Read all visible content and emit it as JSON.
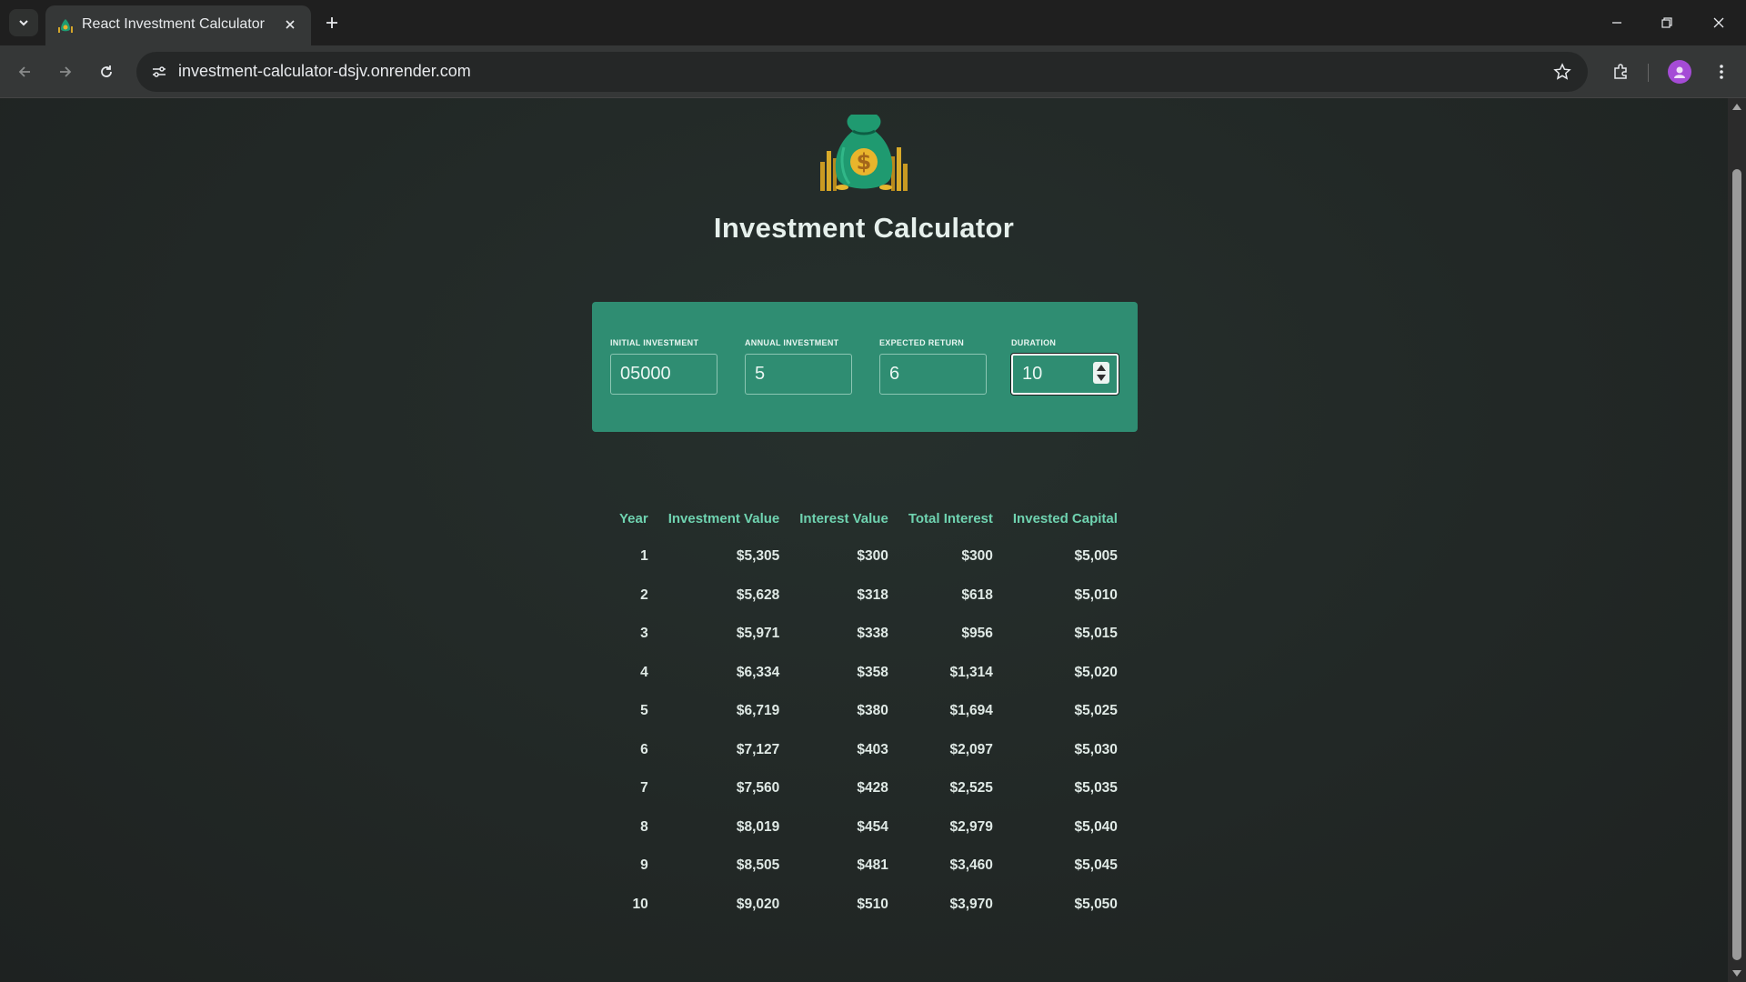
{
  "browser": {
    "tab_title": "React Investment Calculator",
    "url": "investment-calculator-dsjv.onrender.com"
  },
  "app": {
    "title": "Investment Calculator",
    "logo_icon": "money-bag-icon"
  },
  "inputs": [
    {
      "label": "INITIAL INVESTMENT",
      "value": "05000"
    },
    {
      "label": "ANNUAL INVESTMENT",
      "value": "5"
    },
    {
      "label": "EXPECTED RETURN",
      "value": "6"
    },
    {
      "label": "DURATION",
      "value": "10"
    }
  ],
  "table": {
    "headers": [
      "Year",
      "Investment Value",
      "Interest Value",
      "Total Interest",
      "Invested Capital"
    ],
    "rows": [
      [
        "1",
        "$5,305",
        "$300",
        "$300",
        "$5,005"
      ],
      [
        "2",
        "$5,628",
        "$318",
        "$618",
        "$5,010"
      ],
      [
        "3",
        "$5,971",
        "$338",
        "$956",
        "$5,015"
      ],
      [
        "4",
        "$6,334",
        "$358",
        "$1,314",
        "$5,020"
      ],
      [
        "5",
        "$6,719",
        "$380",
        "$1,694",
        "$5,025"
      ],
      [
        "6",
        "$7,127",
        "$403",
        "$2,097",
        "$5,030"
      ],
      [
        "7",
        "$7,560",
        "$428",
        "$2,525",
        "$5,035"
      ],
      [
        "8",
        "$8,019",
        "$454",
        "$2,979",
        "$5,040"
      ],
      [
        "9",
        "$8,505",
        "$481",
        "$3,460",
        "$5,045"
      ],
      [
        "10",
        "$9,020",
        "$510",
        "$3,970",
        "$5,050"
      ]
    ]
  },
  "colors": {
    "panel": "#2f8d72",
    "header_text": "#6fd3b0",
    "background": "#222826"
  }
}
